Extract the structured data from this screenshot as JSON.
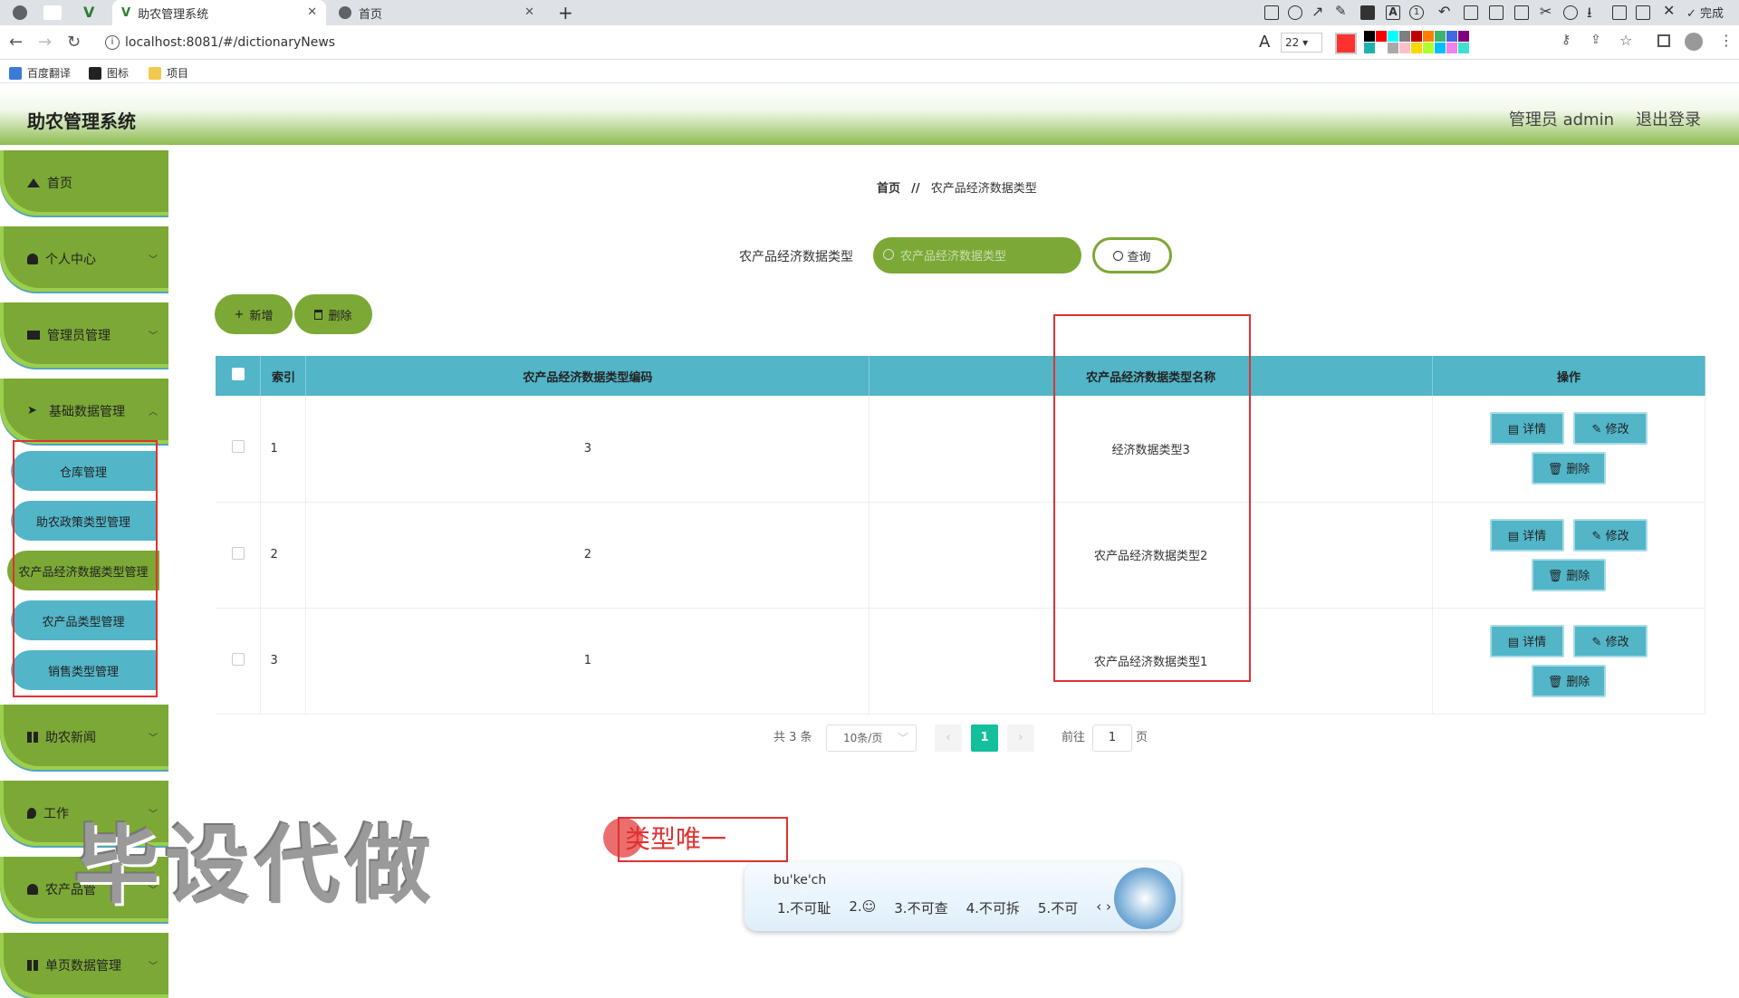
{
  "browser": {
    "tabs": [
      {
        "title": "助农管理系统",
        "active": true
      },
      {
        "title": "首页",
        "active": false
      }
    ],
    "url": "localhost:8081/#/dictionaryNews",
    "annot_toolbar": {
      "font_size": "22",
      "done_label": "完成"
    },
    "bookmarks": [
      "百度翻译",
      "图标",
      "项目"
    ],
    "swatches": [
      "#000000",
      "#ff0000",
      "#00ffff",
      "#7f7f7f",
      "#c00000",
      "#ff7f00",
      "#3cb371",
      "#4169e1",
      "#800080",
      "#20b2aa",
      "#ffffff",
      "#a9a9a9",
      "#ffc0cb",
      "#ffd700",
      "#adff2f",
      "#00bfff",
      "#ee82ee",
      "#40e0d0"
    ]
  },
  "header": {
    "title": "助农管理系统",
    "user": "管理员 admin",
    "logout": "退出登录"
  },
  "sidebar": {
    "menus": [
      {
        "label": "首页",
        "icon": "home-icon"
      },
      {
        "label": "个人中心",
        "icon": "user-icon"
      },
      {
        "label": "管理员管理",
        "icon": "admin-icon"
      },
      {
        "label": "基础数据管理",
        "icon": "send-icon"
      }
    ],
    "submenus": [
      "仓库管理",
      "助农政策类型管理",
      "农产品经济数据类型管理",
      "农产品类型管理",
      "销售类型管理"
    ],
    "menus2": [
      {
        "label": "助农新闻",
        "icon": "grid-icon"
      },
      {
        "label": "工作",
        "icon": "pin-icon"
      },
      {
        "label": "农产品管",
        "icon": "user-icon"
      },
      {
        "label": "单页数据管理",
        "icon": "grid-icon"
      }
    ]
  },
  "breadcrumb": {
    "home": "首页",
    "sep": "//",
    "current": "农产品经济数据类型"
  },
  "search": {
    "label": "农产品经济数据类型",
    "placeholder": "农产品经济数据类型",
    "button": "查询"
  },
  "actions": {
    "add": "新增",
    "delete": "删除"
  },
  "table": {
    "headers": [
      "索引",
      "农产品经济数据类型编码",
      "农产品经济数据类型名称",
      "操作"
    ],
    "rows": [
      {
        "index": "1",
        "code": "3",
        "name": "经济数据类型3"
      },
      {
        "index": "2",
        "code": "2",
        "name": "农产品经济数据类型2"
      },
      {
        "index": "3",
        "code": "1",
        "name": "农产品经济数据类型1"
      }
    ],
    "op_labels": {
      "detail": "详情",
      "edit": "修改",
      "delete": "删除"
    }
  },
  "pagination": {
    "total": "共 3 条",
    "page_size": "10条/页",
    "current": "1",
    "goto": "前往",
    "goto_value": "1",
    "page_unit": "页"
  },
  "overlay": {
    "watermark": "毕设代做",
    "annotation": "类型唯一",
    "ime_input": "bu'ke'ch",
    "ime_candidates": [
      "1.不可耻",
      "2.",
      "3.不可查",
      "4.不可拆",
      "5.不可"
    ]
  }
}
